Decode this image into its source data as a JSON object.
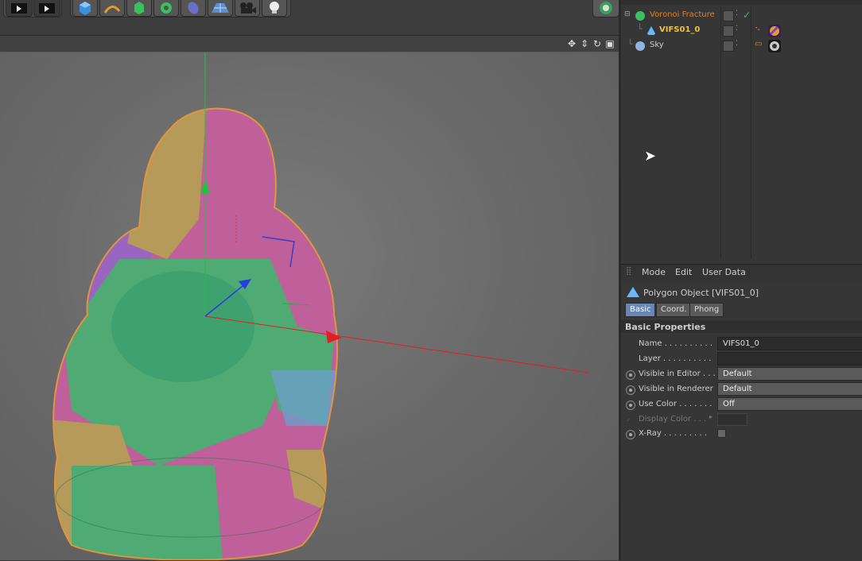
{
  "object_manager": {
    "objects": [
      {
        "name": "Voronoi Fracture",
        "color": "#e0802a",
        "icon": "voronoi-fracture-icon"
      },
      {
        "name": "VIFS01_0",
        "color": "#f2c230",
        "icon": "polygon-object-icon"
      },
      {
        "name": "Sky",
        "color": "#cfcfcf",
        "icon": "sky-icon"
      }
    ]
  },
  "attribute_manager": {
    "menu": [
      "Mode",
      "Edit",
      "User Data"
    ],
    "title": "Polygon Object [VIFS01_0]",
    "tabs": [
      "Basic",
      "Coord.",
      "Phong"
    ],
    "active_tab": "Basic",
    "section": "Basic Properties",
    "properties": [
      {
        "label": "Name . . . . . . . . . .",
        "value": "VIFS01_0",
        "kind": "text"
      },
      {
        "label": "Layer . . . . . . . . . .",
        "value": "",
        "kind": "text"
      },
      {
        "label": "Visible in Editor . . .",
        "value": "Default",
        "kind": "dropdown"
      },
      {
        "label": "Visible in Renderer",
        "value": "Default",
        "kind": "dropdown"
      },
      {
        "label": "Use Color . . . . . . .",
        "value": "Off",
        "kind": "dropdown"
      },
      {
        "label": "Display Color . . .",
        "value": "",
        "kind": "color"
      },
      {
        "label": "X-Ray . . . . . . . . .",
        "value": "",
        "kind": "checkbox"
      }
    ]
  },
  "colors": {
    "accent_tab": "#6a86b4",
    "axis_x": "#e02020",
    "axis_y": "#20c040",
    "axis_z": "#2040e0",
    "segment_pink": "#c0609a",
    "segment_green": "#4faa73",
    "segment_tan": "#b59a5a",
    "segment_purple": "#9a65c0"
  }
}
